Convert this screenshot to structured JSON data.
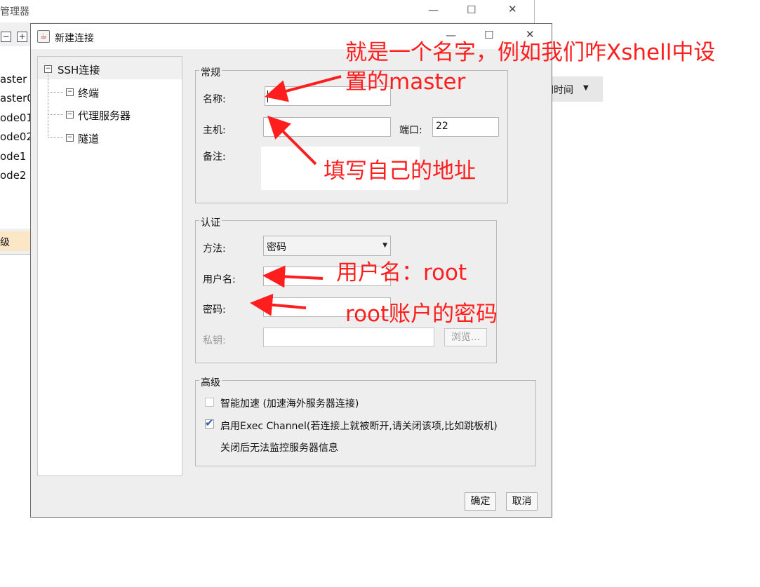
{
  "background_window": {
    "title": "管理器",
    "list_items": [
      "aster",
      "aster0",
      "ode01",
      "ode02",
      "ode1",
      "ode2"
    ],
    "status_text": "级",
    "time_combo": "间时间"
  },
  "dialog": {
    "title": "新建连接",
    "tree": {
      "root": "SSH连接",
      "children": [
        "终端",
        "代理服务器",
        "隧道"
      ]
    },
    "general": {
      "group_label": "常规",
      "name_label": "名称:",
      "name_value": "",
      "host_label": "主机:",
      "host_value": "",
      "port_label": "端口:",
      "port_value": "22",
      "remark_label": "备注:"
    },
    "auth": {
      "group_label": "认证",
      "method_label": "方法:",
      "method_value": "密码",
      "user_label": "用户名:",
      "password_label": "密码:",
      "key_label": "私钥:",
      "browse_label": "浏览..."
    },
    "advanced": {
      "group_label": "高级",
      "smart_accel_label": "智能加速 (加速海外服务器连接)",
      "smart_accel_checked": false,
      "exec_channel_label": "启用Exec Channel(若连接上就被断开,请关闭该项,比如跳板机)",
      "exec_channel_checked": true,
      "exec_channel_note": "关闭后无法监控服务器信息"
    },
    "ok_label": "确定",
    "cancel_label": "取消"
  },
  "annotations": {
    "name_hint_line1": "就是一个名字，例如我们咋Xshell中设",
    "name_hint_line2": "置的master",
    "host_hint": "填写自己的地址",
    "user_hint": "用户名：root",
    "password_hint": "root账户的密码"
  },
  "colors": {
    "annotation": "#ff1e1e",
    "dialog_bg": "#eeeeee",
    "check_accent": "#2a5ea8"
  },
  "icons": [
    "java-icon",
    "minimize-icon",
    "maximize-icon",
    "close-icon",
    "tree-collapse-icon",
    "dropdown-arrow-icon",
    "checkmark-icon",
    "arrow-annotation-icon"
  ]
}
